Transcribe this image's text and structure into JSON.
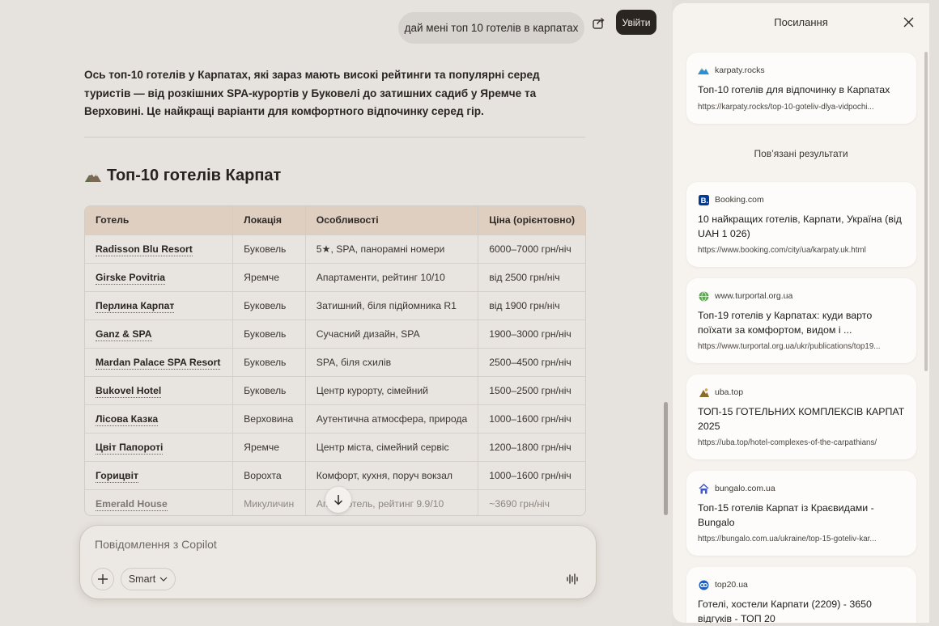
{
  "chat": {
    "user_message": "дай мені топ 10 готелів в карпатах",
    "login_label": "Увійти",
    "intro": "Ось топ-10 готелів у Карпатах, які зараз мають високі рейтинги та популярні серед туристів — від розкішних SPA-курортів у Буковелі до затишних садиб у Яремче та Верховині. Це найкращі варіанти для комфортного відпочинку серед гір.",
    "section_title": "Топ-10 готелів Карпат",
    "table": {
      "headers": [
        "Готель",
        "Локація",
        "Особливості",
        "Ціна (орієнтовно)"
      ],
      "rows": [
        {
          "hotel": "Radisson Blu Resort",
          "location": "Буковель",
          "features": "5★, SPA, панорамні номери",
          "price": "6000–7000 грн/ніч"
        },
        {
          "hotel": "Girske Povitria",
          "location": "Яремче",
          "features": "Апартаменти, рейтинг 10/10",
          "price": "від 2500 грн/ніч"
        },
        {
          "hotel": "Перлина Карпат",
          "location": "Буковель",
          "features": "Затишний, біля підйомника R1",
          "price": "від 1900 грн/ніч"
        },
        {
          "hotel": "Ganz & SPA",
          "location": "Буковель",
          "features": "Сучасний дизайн, SPA",
          "price": "1900–3000 грн/ніч"
        },
        {
          "hotel": "Mardan Palace SPA Resort",
          "location": "Буковель",
          "features": "SPA, біля схилів",
          "price": "2500–4500 грн/ніч"
        },
        {
          "hotel": "Bukovel Hotel",
          "location": "Буковель",
          "features": "Центр курорту, сімейний",
          "price": "1500–2500 грн/ніч"
        },
        {
          "hotel": "Лісова Казка",
          "location": "Верховина",
          "features": "Аутентична атмосфера, природа",
          "price": "1000–1600 грн/ніч"
        },
        {
          "hotel": "Цвіт Папороті",
          "location": "Яремче",
          "features": "Центр міста, сімейний сервіс",
          "price": "1200–1800 грн/ніч"
        },
        {
          "hotel": "Горицвіт",
          "location": "Ворохта",
          "features": "Комфорт, кухня, поруч вокзал",
          "price": "1000–1600 грн/ніч"
        },
        {
          "hotel": "Emerald House",
          "location": "Микуличин",
          "features": "Апартготель, рейтинг 9.9/10",
          "price": "~3690 грн/ніч"
        }
      ]
    },
    "composer": {
      "placeholder": "Повідомлення з Copilot",
      "mode_label": "Smart"
    }
  },
  "panel": {
    "title": "Посилання",
    "related_label": "Пов’язані результати",
    "primary_card": {
      "site": "karpaty.rocks",
      "title": "Топ-10 готелів для відпочинку в Карпатах",
      "url": "https://karpaty.rocks/top-10-goteliv-dlya-vidpochi..."
    },
    "related": [
      {
        "site": "Booking.com",
        "icon": "booking-icon",
        "title": "10 найкращих готелів, Карпати, Україна (від UAH 1 026)",
        "url": "https://www.booking.com/city/ua/karpaty.uk.html"
      },
      {
        "site": "www.turportal.org.ua",
        "icon": "globe-icon",
        "title": "Топ-19 готелів у Карпатах: куди варто поїхати за комфортом, видом і ...",
        "url": "https://www.turportal.org.ua/ukr/publications/top19..."
      },
      {
        "site": "uba.top",
        "icon": "uba-icon",
        "title": "ТОП-15 ГОТЕЛЬНИХ КОМПЛЕКСІВ КАРПАТ 2025",
        "url": "https://uba.top/hotel-complexes-of-the-carpathians/"
      },
      {
        "site": "bungalo.com.ua",
        "icon": "bungalo-icon",
        "title": "Топ-15 готелів Карпат із Краєвидами - Bungalo",
        "url": "https://bungalo.com.ua/ukraine/top-15-goteliv-kar..."
      },
      {
        "site": "top20.ua",
        "icon": "top20-icon",
        "title": "Готелі, хостели Карпати (2209) - 3650 відгуків - ТОП 20",
        "url": ""
      }
    ]
  },
  "colors": {
    "accent_dark": "#2b2522",
    "table_header": "#decfc0",
    "panel_bg": "#f6f3ef",
    "booking_blue": "#003b95"
  }
}
